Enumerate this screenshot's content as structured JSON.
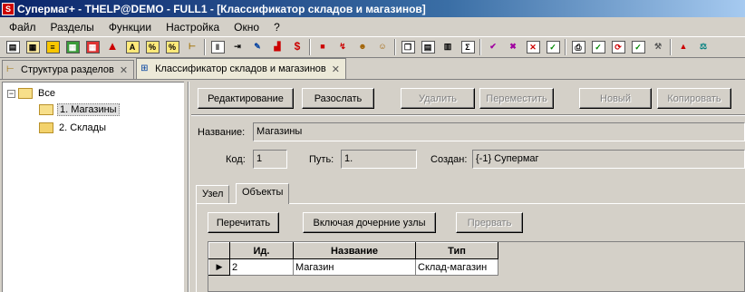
{
  "window": {
    "title": "Супермаг+ - THELP@DEMO - FULL1  - [Классификатор складов и магазинов]"
  },
  "menu": [
    "Файл",
    "Разделы",
    "Функции",
    "Настройка",
    "Окно",
    "?"
  ],
  "doc_tabs": [
    {
      "label": "Структура разделов",
      "active": false
    },
    {
      "label": "Классификатор складов и магазинов",
      "active": true
    }
  ],
  "tree": {
    "root": "Все",
    "items": [
      "1. Магазины",
      "2. Склады"
    ]
  },
  "actions": {
    "edit": "Редактирование",
    "send": "Разослать",
    "delete": "Удалить",
    "move": "Переместить",
    "new": "Новый",
    "copy": "Копировать"
  },
  "form": {
    "name_label": "Название:",
    "name_value": "Магазины",
    "code_label": "Код:",
    "code_value": "1",
    "path_label": "Путь:",
    "path_value": "1.",
    "created_label": "Создан:",
    "created_value": "{-1} Супермаг"
  },
  "subtabs": [
    "Узел",
    "Объекты"
  ],
  "objects": {
    "reread": "Перечитать",
    "include_children": "Включая дочерние узлы",
    "interrupt": "Прервать",
    "columns": [
      "Ид.",
      "Название",
      "Тип"
    ],
    "rows": [
      [
        "2",
        "Магазин",
        "Склад-магазин"
      ]
    ]
  }
}
